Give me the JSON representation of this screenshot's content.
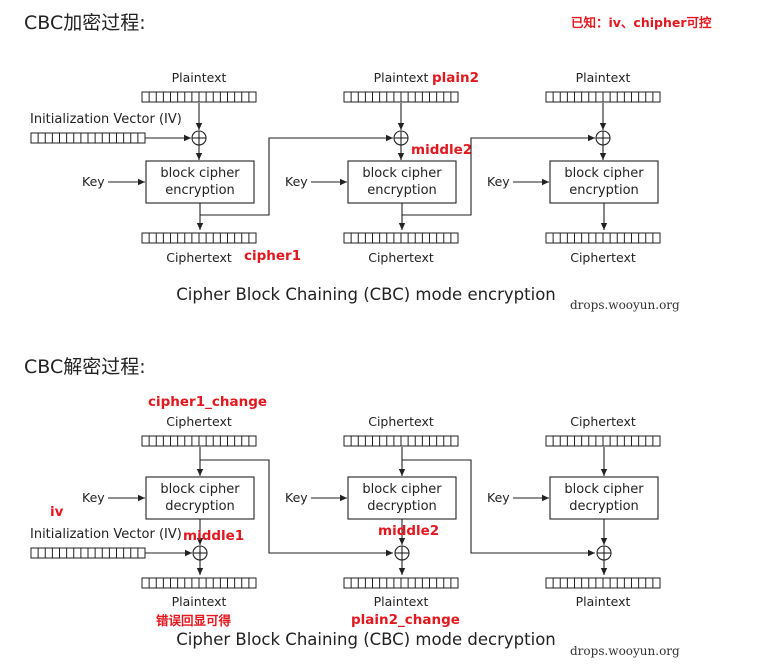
{
  "headings": {
    "encryption": "CBC加密过程:",
    "decryption": "CBC解密过程:"
  },
  "note": "已知：iv、chipher可控",
  "encryption": {
    "plaintext": "Plaintext",
    "ciphertext": "Ciphertext",
    "iv": "Initialization Vector (IV)",
    "key": "Key",
    "block_line1": "block cipher",
    "block_line2": "encryption",
    "caption": "Cipher Block Chaining (CBC) mode encryption",
    "annotations": {
      "plain2": "plain2",
      "middle2": "middle2",
      "cipher1": "cipher1"
    }
  },
  "decryption": {
    "plaintext": "Plaintext",
    "ciphertext": "Ciphertext",
    "iv": "Initialization Vector (IV)",
    "key": "Key",
    "block_line1": "block cipher",
    "block_line2": "decryption",
    "caption": "Cipher Block Chaining (CBC) mode decryption",
    "annotations": {
      "cipher1_change": "cipher1_change",
      "iv": "iv",
      "middle1": "middle1",
      "middle2": "middle2",
      "error_echo": "错误回显可得",
      "plain2_change": "plain2_change"
    }
  },
  "watermark": "drops.wooyun.org",
  "colors": {
    "annotation": "#e3181f",
    "stroke": "#222222"
  }
}
